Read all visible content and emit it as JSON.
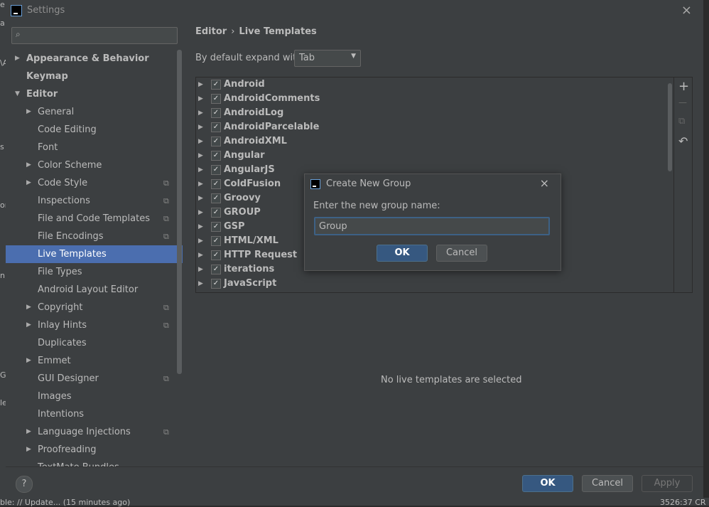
{
  "background": {
    "left_strip": [
      "e",
      "a",
      "\\A",
      "s",
      "on",
      "n,",
      "G",
      "le"
    ],
    "bottom_left": "ble: // Update... (15 minutes ago)",
    "bottom_right": "3526:37 CR"
  },
  "window": {
    "title": "Settings",
    "close_icon": "×"
  },
  "sidebar": {
    "search_placeholder": "",
    "search_icon": "⌕",
    "items": [
      {
        "label": "Appearance & Behavior",
        "arrow": "▶",
        "indent": 0,
        "bold": true
      },
      {
        "label": "Keymap",
        "arrow": "",
        "indent": 0,
        "bold": true
      },
      {
        "label": "Editor",
        "arrow": "▼",
        "indent": 0,
        "bold": true
      },
      {
        "label": "General",
        "arrow": "▶",
        "indent": 1
      },
      {
        "label": "Code Editing",
        "arrow": "",
        "indent": 1
      },
      {
        "label": "Font",
        "arrow": "",
        "indent": 1
      },
      {
        "label": "Color Scheme",
        "arrow": "▶",
        "indent": 1
      },
      {
        "label": "Code Style",
        "arrow": "▶",
        "indent": 1,
        "copy": "⧉"
      },
      {
        "label": "Inspections",
        "arrow": "",
        "indent": 1,
        "copy": "⧉"
      },
      {
        "label": "File and Code Templates",
        "arrow": "",
        "indent": 1,
        "copy": "⧉"
      },
      {
        "label": "File Encodings",
        "arrow": "",
        "indent": 1,
        "copy": "⧉"
      },
      {
        "label": "Live Templates",
        "arrow": "",
        "indent": 1,
        "selected": true
      },
      {
        "label": "File Types",
        "arrow": "",
        "indent": 1
      },
      {
        "label": "Android Layout Editor",
        "arrow": "",
        "indent": 1
      },
      {
        "label": "Copyright",
        "arrow": "▶",
        "indent": 1,
        "copy": "⧉"
      },
      {
        "label": "Inlay Hints",
        "arrow": "▶",
        "indent": 1,
        "copy": "⧉"
      },
      {
        "label": "Duplicates",
        "arrow": "",
        "indent": 1
      },
      {
        "label": "Emmet",
        "arrow": "▶",
        "indent": 1
      },
      {
        "label": "GUI Designer",
        "arrow": "",
        "indent": 1,
        "copy": "⧉"
      },
      {
        "label": "Images",
        "arrow": "",
        "indent": 1
      },
      {
        "label": "Intentions",
        "arrow": "",
        "indent": 1
      },
      {
        "label": "Language Injections",
        "arrow": "▶",
        "indent": 1,
        "copy": "⧉"
      },
      {
        "label": "Proofreading",
        "arrow": "▶",
        "indent": 1
      },
      {
        "label": "TextMate Bundles",
        "arrow": "",
        "indent": 1
      }
    ]
  },
  "main": {
    "breadcrumb": {
      "parent": "Editor",
      "separator": "›",
      "current": "Live Templates"
    },
    "expand_label": "By default expand with",
    "expand_value": "Tab",
    "templates": [
      "Android",
      "AndroidComments",
      "AndroidLog",
      "AndroidParcelable",
      "AndroidXML",
      "Angular",
      "AngularJS",
      "ColdFusion",
      "Groovy",
      "GROUP",
      "GSP",
      "HTML/XML",
      "HTTP Request",
      "iterations",
      "JavaScript"
    ],
    "toolbar": {
      "add": "+",
      "remove": "—",
      "copy": "⧉",
      "restore": "↶"
    },
    "no_selection": "No live templates are selected"
  },
  "footer": {
    "help": "?",
    "ok": "OK",
    "cancel": "Cancel",
    "apply": "Apply"
  },
  "dialog": {
    "title": "Create New Group",
    "close_icon": "×",
    "prompt": "Enter the new group name:",
    "value": "Group",
    "ok": "OK",
    "cancel": "Cancel"
  }
}
